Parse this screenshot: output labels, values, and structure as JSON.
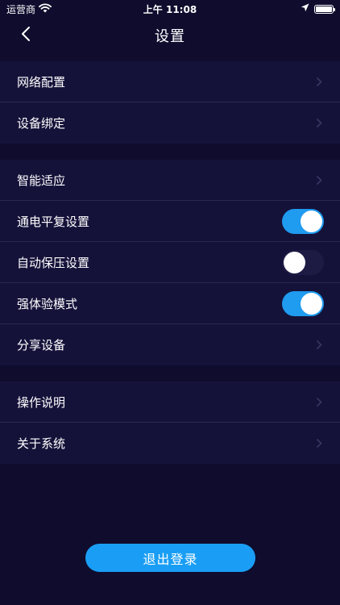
{
  "status_bar": {
    "carrier": "运营商",
    "time": "上午 11:08",
    "icons": [
      "wifi-icon",
      "location-arrow-icon",
      "battery-icon"
    ]
  },
  "nav": {
    "title": "设置",
    "back_icon": "chevron-left-icon"
  },
  "groups": [
    {
      "items": [
        {
          "label": "网络配置",
          "control": "chevron"
        },
        {
          "label": "设备绑定",
          "control": "chevron"
        }
      ]
    },
    {
      "items": [
        {
          "label": "智能适应",
          "control": "chevron"
        },
        {
          "label": "通电平复设置",
          "control": "toggle",
          "on": true
        },
        {
          "label": "自动保压设置",
          "control": "toggle",
          "on": false
        },
        {
          "label": "强体验模式",
          "control": "toggle",
          "on": true
        },
        {
          "label": "分享设备",
          "control": "chevron"
        }
      ]
    },
    {
      "items": [
        {
          "label": "操作说明",
          "control": "chevron"
        },
        {
          "label": "关于系统",
          "control": "chevron"
        }
      ]
    }
  ],
  "logout_label": "退出登录",
  "colors": {
    "background": "#0f0c2e",
    "group_background": "#15123a",
    "accent": "#1a9ef5",
    "divider": "#2a2652"
  }
}
